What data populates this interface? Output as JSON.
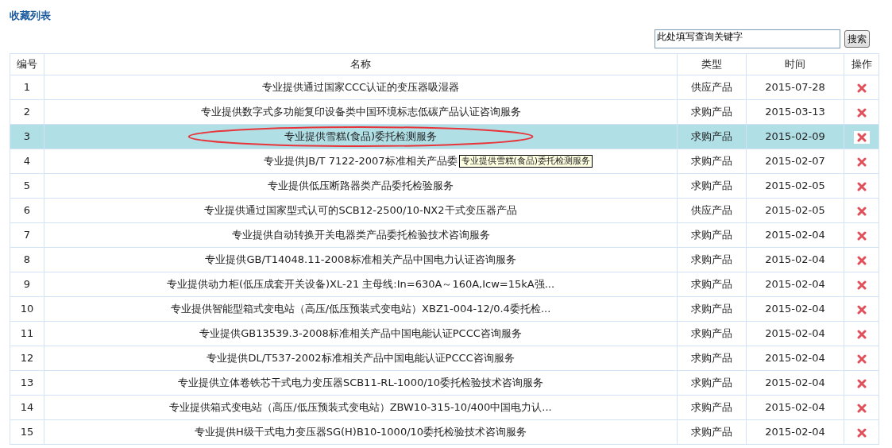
{
  "title": "收藏列表",
  "search": {
    "placeholder": "此处填写查询关键字",
    "button": "搜索"
  },
  "table": {
    "columns": [
      "编号",
      "名称",
      "类型",
      "时间",
      "操作"
    ],
    "rows": [
      {
        "no": "1",
        "name": "专业提供通过国家CCC认证的变压器吸湿器",
        "type": "供应产品",
        "date": "2015-07-28",
        "selected": false,
        "circled": false
      },
      {
        "no": "2",
        "name": "专业提供数字式多功能复印设备类中国环境标志低碳产品认证咨询服务",
        "type": "求购产品",
        "date": "2015-03-13",
        "selected": false,
        "circled": false
      },
      {
        "no": "3",
        "name": "专业提供雪糕(食品)委托检测服务",
        "type": "求购产品",
        "date": "2015-02-09",
        "selected": true,
        "circled": true
      },
      {
        "no": "4",
        "name": "专业提供JB/T 7122-2007标准相关产品委",
        "type": "求购产品",
        "date": "2015-02-07",
        "selected": false,
        "circled": false,
        "tooltip": "专业提供雪糕(食品)委托检测服务"
      },
      {
        "no": "5",
        "name": "专业提供低压断路器类产品委托检验服务",
        "type": "求购产品",
        "date": "2015-02-05",
        "selected": false,
        "circled": false
      },
      {
        "no": "6",
        "name": "专业提供通过国家型式认可的SCB12-2500/10-NX2干式变压器产品",
        "type": "供应产品",
        "date": "2015-02-05",
        "selected": false,
        "circled": false
      },
      {
        "no": "7",
        "name": "专业提供自动转换开关电器类产品委托检验技术咨询服务",
        "type": "求购产品",
        "date": "2015-02-04",
        "selected": false,
        "circled": false
      },
      {
        "no": "8",
        "name": "专业提供GB/T14048.11-2008标准相关产品中国电力认证咨询服务",
        "type": "求购产品",
        "date": "2015-02-04",
        "selected": false,
        "circled": false
      },
      {
        "no": "9",
        "name": "专业提供动力柜(低压成套开关设备)XL-21 主母线:In=630A～160A,Icw=15kA强...",
        "type": "求购产品",
        "date": "2015-02-04",
        "selected": false,
        "circled": false
      },
      {
        "no": "10",
        "name": "专业提供智能型箱式变电站（高压/低压预装式变电站）XBZ1-004-12/0.4委托检...",
        "type": "求购产品",
        "date": "2015-02-04",
        "selected": false,
        "circled": false
      },
      {
        "no": "11",
        "name": "专业提供GB13539.3-2008标准相关产品中国电能认证PCCC咨询服务",
        "type": "求购产品",
        "date": "2015-02-04",
        "selected": false,
        "circled": false
      },
      {
        "no": "12",
        "name": "专业提供DL/T537-2002标准相关产品中国电能认证PCCC咨询服务",
        "type": "求购产品",
        "date": "2015-02-04",
        "selected": false,
        "circled": false
      },
      {
        "no": "13",
        "name": "专业提供立体卷铁芯干式电力变压器SCB11-RL-1000/10委托检验技术咨询服务",
        "type": "求购产品",
        "date": "2015-02-04",
        "selected": false,
        "circled": false
      },
      {
        "no": "14",
        "name": "专业提供箱式变电站（高压/低压预装式变电站）ZBW10-315-10/400中国电力认...",
        "type": "求购产品",
        "date": "2015-02-04",
        "selected": false,
        "circled": false
      },
      {
        "no": "15",
        "name": "专业提供H级干式电力变压器SG(H)B10-1000/10委托检验技术咨询服务",
        "type": "求购产品",
        "date": "2015-02-04",
        "selected": false,
        "circled": false
      }
    ]
  }
}
